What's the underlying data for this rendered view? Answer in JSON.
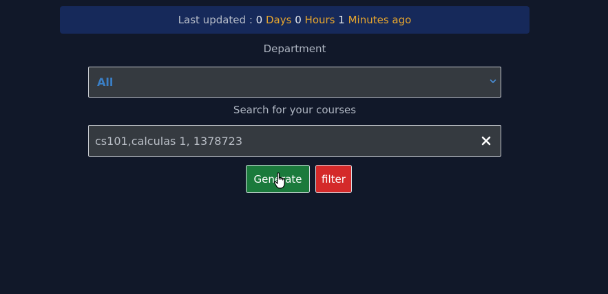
{
  "status": {
    "prefix": "Last updated :",
    "days_value": "0",
    "days_label": "Days",
    "hours_value": "0",
    "hours_label": "Hours",
    "minutes_value": "1",
    "minutes_label": "Minutes ago"
  },
  "department": {
    "label": "Department",
    "selected": "All",
    "icon": "chevron-down-icon"
  },
  "search": {
    "label": "Search for your courses",
    "value": "cs101,calculas 1, 1378723",
    "clear_icon": "close-icon"
  },
  "actions": {
    "generate_label": "Generate",
    "filter_label": "filter"
  },
  "colors": {
    "background": "#111829",
    "banner": "#16295a",
    "accent_orange": "#e6a52e",
    "select_value": "#3a7fc6",
    "generate": "#1b7a3c",
    "filter": "#d42a2a"
  }
}
